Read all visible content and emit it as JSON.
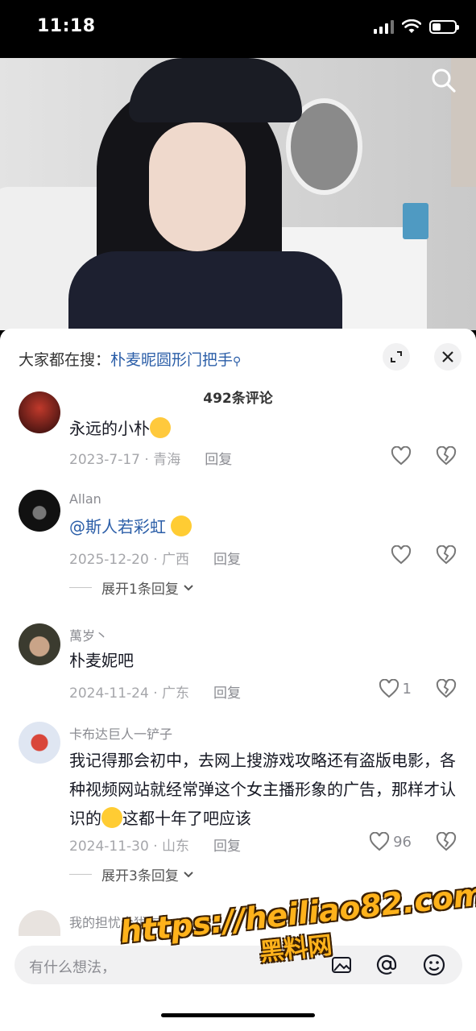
{
  "status_bar": {
    "time": "11:18"
  },
  "video": {
    "search_icon": "search-icon"
  },
  "sheet": {
    "hot_search_prefix": "大家都在搜：",
    "hot_search_keyword": "朴麦昵圆形门把手",
    "comment_count": "492条评论"
  },
  "comments": [
    {
      "username": "",
      "text": "永远的小朴",
      "date": "2023-7-17 · 青海",
      "reply_label": "回复",
      "likes": ""
    },
    {
      "username": "Allan",
      "mention": "@斯人若彩虹",
      "date": "2025-12-20 · 广西",
      "reply_label": "回复",
      "likes": "",
      "expand": "展开1条回复"
    },
    {
      "username": "萬岁丶",
      "text": "朴麦妮吧",
      "date": "2024-11-24 · 广东",
      "reply_label": "回复",
      "likes": "1"
    },
    {
      "username": "卡布达巨人一铲子",
      "text_part1": "我记得那会初中，去网上搜游戏攻略还有盗版电影，各种视频网站就经常弹这个女主播形象的广告，那样才认识的",
      "text_part2": "这都十年了吧应该",
      "date": "2024-11-30 · 山东",
      "reply_label": "回复",
      "likes": "96",
      "expand": "展开3条回复"
    },
    {
      "username": "我的担忧今犹在-"
    }
  ],
  "input": {
    "placeholder": "有什么想法，"
  },
  "watermark": {
    "url": "https://heiliao82.com",
    "cn": "黑料网"
  }
}
